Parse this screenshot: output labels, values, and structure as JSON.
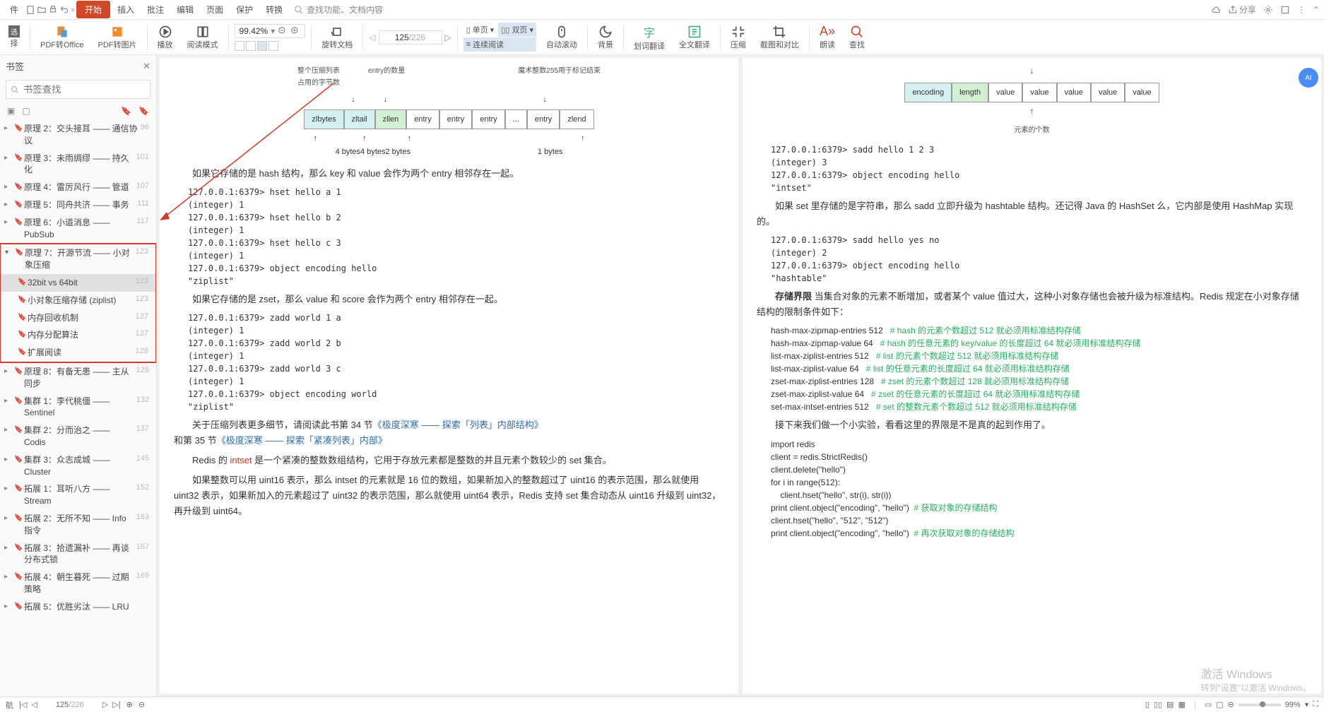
{
  "menu": {
    "items": [
      "件",
      "开始",
      "插入",
      "批注",
      "编辑",
      "页面",
      "保护",
      "转换"
    ],
    "search_ph": "查找功能、文档内容",
    "share": "分享"
  },
  "ribbon": {
    "pdf_office": "PDF转Office",
    "pdf_img": "PDF转图片",
    "play": "播放",
    "read_mode": "阅读模式",
    "zoom": "99.42%",
    "page_cur": "125",
    "page_tot": "/226",
    "rotate": "旋转文档",
    "single": "单页",
    "double": "双页",
    "cont": "连续阅读",
    "autoscroll": "自动滚动",
    "bg": "背景",
    "huaci": "划词翻译",
    "fulltrans": "全文翻译",
    "compress": "压缩",
    "crop": "截图和对比",
    "speak": "朗读",
    "find": "查找"
  },
  "sidebar": {
    "title": "书签",
    "search_ph": "书签查找",
    "items": [
      {
        "lbl": "原理 2：交头接耳 —— 通信协议",
        "pg": "96"
      },
      {
        "lbl": "原理 3：未雨绸缪 —— 持久化",
        "pg": "101"
      },
      {
        "lbl": "原理 4：雷厉风行 —— 管道",
        "pg": "107"
      },
      {
        "lbl": "原理 5：同舟共济 —— 事务",
        "pg": "111"
      },
      {
        "lbl": "原理 6：小道消息 —— PubSub",
        "pg": "117"
      },
      {
        "lbl": "原理 7：开源节流 —— 小对象压缩",
        "pg": "123",
        "open": true,
        "children": [
          {
            "lbl": "32bit vs 64bit",
            "pg": "123",
            "sel": true
          },
          {
            "lbl": "小对象压缩存储 (ziplist)",
            "pg": "123"
          },
          {
            "lbl": "内存回收机制",
            "pg": "127"
          },
          {
            "lbl": "内存分配算法",
            "pg": "127"
          },
          {
            "lbl": "扩展阅读",
            "pg": "128"
          }
        ]
      },
      {
        "lbl": "原理 8：有备无患 —— 主从同步",
        "pg": "128"
      },
      {
        "lbl": "集群 1：李代桃僵 —— Sentinel",
        "pg": "132"
      },
      {
        "lbl": "集群 2：分而治之 —— Codis",
        "pg": "137"
      },
      {
        "lbl": "集群 3：众志成城 —— Cluster",
        "pg": "145"
      },
      {
        "lbl": "拓展 1：耳听八方 —— Stream",
        "pg": "152"
      },
      {
        "lbl": "拓展 2：无所不知 —— Info 指令",
        "pg": "163"
      },
      {
        "lbl": "拓展 3：拾遗漏补 —— 再谈分布式锁",
        "pg": "167"
      },
      {
        "lbl": "拓展 4：朝生暮死 —— 过期策略",
        "pg": "169"
      },
      {
        "lbl": "拓展 5：优胜劣汰 —— LRU",
        "pg": ""
      }
    ]
  },
  "pageL": {
    "diag": {
      "top1": "整个压缩列表\n占用的字节数",
      "top2": "entry的数量",
      "top3": "魔术整数255用于标记结束",
      "cells": [
        "zlbytes",
        "zltail",
        "zllen",
        "entry",
        "entry",
        "entry",
        "...",
        "entry",
        "zlend"
      ],
      "bytes": [
        "4 bytes",
        "4 bytes",
        "2 bytes",
        "1 bytes"
      ]
    },
    "p1": "如果它存储的是 hash 结构，那么 key 和 value 会作为两个 entry 相邻存在一起。",
    "code1": "127.0.0.1:6379> hset hello a 1\n(integer) 1\n127.0.0.1:6379> hset hello b 2\n(integer) 1\n127.0.0.1:6379> hset hello c 3\n(integer) 1\n127.0.0.1:6379> object encoding hello\n\"ziplist\"",
    "p2": "如果它存储的是 zset，那么 value 和 score 会作为两个 entry 相邻存在一起。",
    "code2": "127.0.0.1:6379> zadd world 1 a\n(integer) 1\n127.0.0.1:6379> zadd world 2 b\n(integer) 1\n127.0.0.1:6379> zadd world 3 c\n(integer) 1\n127.0.0.1:6379> object encoding world\n\"ziplist\"",
    "p3a": "关于压缩列表更多细节，请阅读此书第 34 节",
    "p3b": "《极度深寒 —— 探索「列表」内部结构》",
    "p3c": "和第 35 节",
    "p3d": "《极度深寒 —— 探索「紧凑列表」内部》",
    "p4a": "Redis 的 ",
    "p4b": "intset",
    "p4c": " 是一个紧凑的整数数组结构，它用于存放元素都是整数的并且元素个数较少的 set 集合。",
    "p5": "如果整数可以用 uint16 表示，那么 intset 的元素就是 16 位的数组，如果新加入的整数超过了 uint16 的表示范围，那么就使用 uint32 表示，如果新加入的元素超过了 uint32 的表示范围，那么就使用 uint64 表示，Redis 支持 set 集合动态从 uint16 升级到 uint32，再升级到 uint64。"
  },
  "pageR": {
    "diag": {
      "cells": [
        "encoding",
        "length",
        "value",
        "value",
        "value",
        "value",
        "value"
      ],
      "caption": "元素的个数"
    },
    "code1": "127.0.0.1:6379> sadd hello 1 2 3\n(integer) 3\n127.0.0.1:6379> object encoding hello\n\"intset\"",
    "p1": "如果 set 里存储的是字符串，那么 sadd 立即升级为 hashtable 结构。还记得 Java 的 HashSet 么，它内部是使用 HashMap 实现的。",
    "code2": "127.0.0.1:6379> sadd hello yes no\n(integer) 2\n127.0.0.1:6379> object encoding hello\n\"hashtable\"",
    "p2a": "存储界限",
    "p2b": " 当集合对象的元素不断增加，或者某个 value 值过大，这种小对象存储也会被升级为标准结构。Redis 规定在小对象存储结构的限制条件如下：",
    "cfg": [
      [
        "hash-max-zipmap-entries 512",
        "# hash 的元素个数超过 512 就必须用标准结构存储"
      ],
      [
        "hash-max-zipmap-value 64",
        "# hash 的任意元素的 key/value 的长度超过 64 就必须用标准结构存储"
      ],
      [
        "list-max-ziplist-entries 512",
        "# list 的元素个数超过 512 就必须用标准结构存储"
      ],
      [
        "list-max-ziplist-value 64",
        "# list 的任意元素的长度超过 64 就必须用标准结构存储"
      ],
      [
        "zset-max-ziplist-entries 128",
        "# zset 的元素个数超过 128 就必须用标准结构存储"
      ],
      [
        "zset-max-ziplist-value 64",
        "# zset 的任意元素的长度超过 64 就必须用标准结构存储"
      ],
      [
        "set-max-intset-entries 512",
        "# set 的整数元素个数超过 512 就必须用标准结构存储"
      ]
    ],
    "p3": "接下来我们做一个小实验，看看这里的界限是不是真的起到作用了。",
    "code3": [
      [
        "import redis",
        ""
      ],
      [
        "client = redis.StrictRedis()",
        ""
      ],
      [
        "client.delete(\"hello\")",
        ""
      ],
      [
        "for i in range(512):",
        ""
      ],
      [
        "    client.hset(\"hello\", str(i), str(i))",
        ""
      ],
      [
        "print client.object(\"encoding\", \"hello\")",
        "  # 获取对象的存储结构"
      ],
      [
        "client.hset(\"hello\", \"512\", \"512\")",
        ""
      ],
      [
        "print client.object(\"encoding\", \"hello\")",
        "  # 再次获取对象的存储结构"
      ]
    ]
  },
  "status": {
    "page_cur": "125",
    "page_tot": "/226",
    "zoom": "99%"
  },
  "wm": {
    "t": "激活 Windows",
    "s": "转到\"设置\"以激活 Windows。"
  }
}
